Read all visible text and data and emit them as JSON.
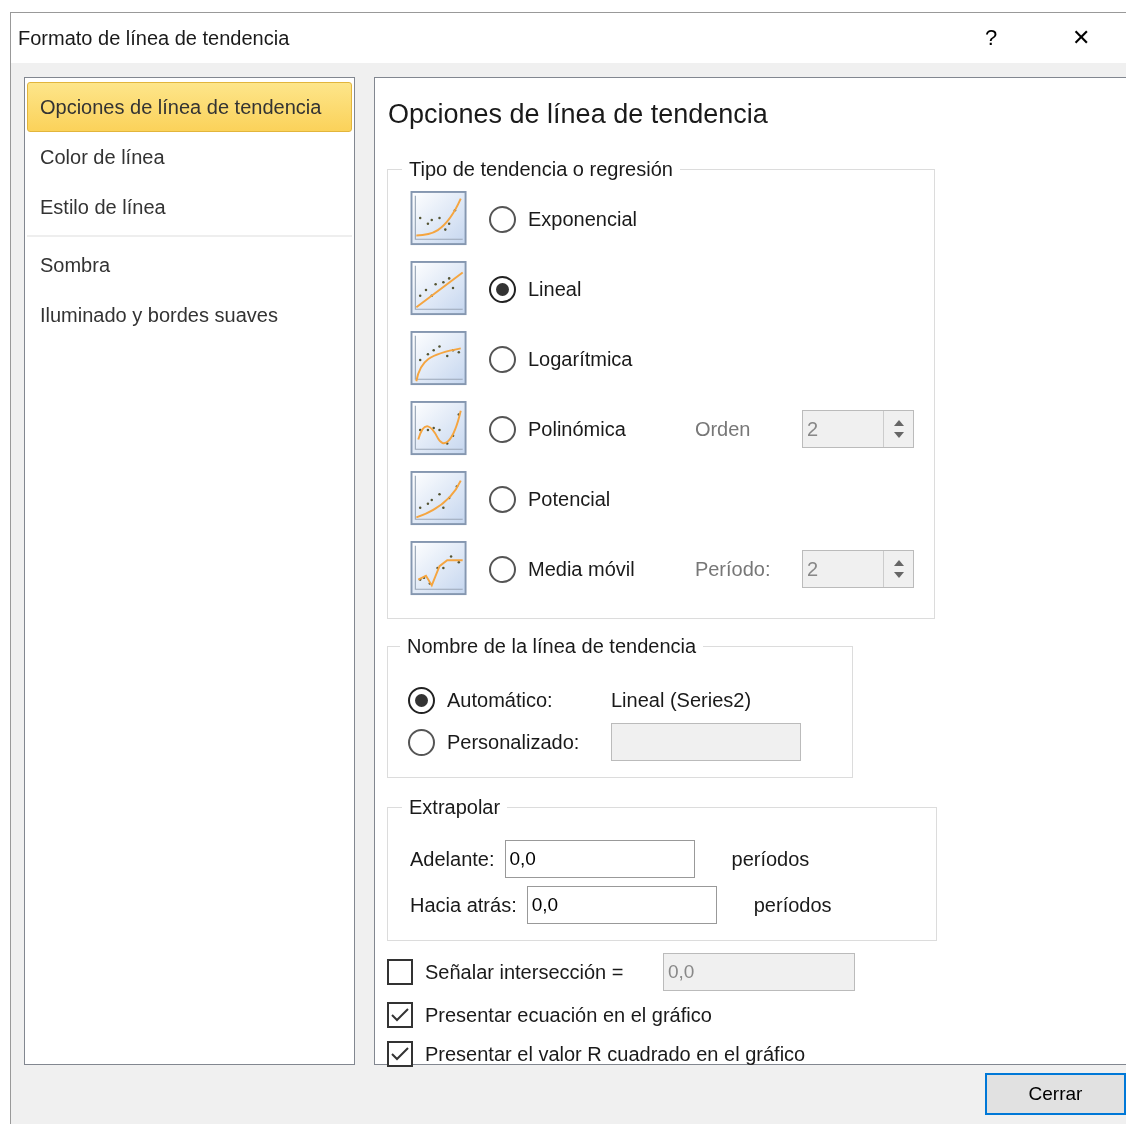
{
  "window": {
    "title": "Formato de línea de tendencia",
    "help": "?",
    "close": "✕"
  },
  "sidebar": {
    "groups": [
      [
        {
          "label": "Opciones de línea de tendencia",
          "selected": true
        },
        {
          "label": "Color de línea",
          "selected": false
        },
        {
          "label": "Estilo de línea",
          "selected": false
        }
      ],
      [
        {
          "label": "Sombra",
          "selected": false
        },
        {
          "label": "Iluminado y bordes suaves",
          "selected": false
        }
      ]
    ]
  },
  "panel": {
    "title": "Opciones de línea de tendencia",
    "trend_type": {
      "legend": "Tipo de tendencia o regresión",
      "options": [
        {
          "kind": "exponential",
          "label": "Exponencial",
          "selected": false
        },
        {
          "kind": "linear",
          "label": "Lineal",
          "selected": true
        },
        {
          "kind": "logarithmic",
          "label": "Logarítmica",
          "selected": false
        },
        {
          "kind": "polynomial",
          "label": "Polinómica",
          "selected": false,
          "param": {
            "label": "Orden",
            "value": "2",
            "disabled": true
          }
        },
        {
          "kind": "power",
          "label": "Potencial",
          "selected": false
        },
        {
          "kind": "moving_average",
          "label": "Media móvil",
          "selected": false,
          "param": {
            "label": "Período:",
            "value": "2",
            "disabled": true
          }
        }
      ]
    },
    "trend_name": {
      "legend": "Nombre de la línea de tendencia",
      "options": [
        {
          "label": "Automático:",
          "selected": true,
          "value": "Lineal (Series2)"
        },
        {
          "label": "Personalizado:",
          "selected": false,
          "field": {
            "disabled": true
          }
        }
      ]
    },
    "extrapolate": {
      "legend": "Extrapolar",
      "rows": [
        {
          "label": "Adelante:",
          "value": "0,0",
          "unit": "períodos"
        },
        {
          "label": "Hacia atrás:",
          "value": "0,0",
          "unit": "períodos"
        }
      ]
    },
    "checkboxes": [
      {
        "label": "Señalar intersección =",
        "checked": false,
        "field": {
          "value": "0,0",
          "disabled": true
        }
      },
      {
        "label": "Presentar ecuación en el gráfico",
        "checked": true
      },
      {
        "label": "Presentar el valor R cuadrado en el gráfico",
        "checked": true
      }
    ]
  },
  "buttons": [
    {
      "label": "Cerrar",
      "default": true
    }
  ]
}
